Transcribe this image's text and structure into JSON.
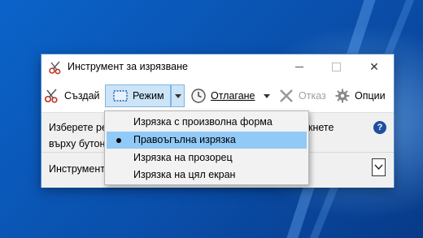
{
  "window": {
    "title": "Инструмент за изрязване",
    "controls": {
      "minimize": "",
      "maximize": "",
      "close": "✕"
    }
  },
  "toolbar": {
    "new_label": "Създай",
    "mode_label": "Режим",
    "delay_label": "Отлагане",
    "cancel_label": "Отказ",
    "options_label": "Опции"
  },
  "content": {
    "description_line1": "Изберете реж",
    "description_line2": "върху бутона",
    "description_right": "кнете",
    "help": "?",
    "status_text": "Инструмент"
  },
  "mode_menu": {
    "items": [
      {
        "label": "Изрязка с произволна форма",
        "selected": false
      },
      {
        "label": "Правоъгълна изрязка",
        "selected": true
      },
      {
        "label": "Изрязка на прозорец",
        "selected": false
      },
      {
        "label": "Изрязка на цял екран",
        "selected": false
      }
    ]
  },
  "colors": {
    "selection": "#91c9f7",
    "toolbar_active": "#cce4f7",
    "desktop": "#0a58b8"
  }
}
